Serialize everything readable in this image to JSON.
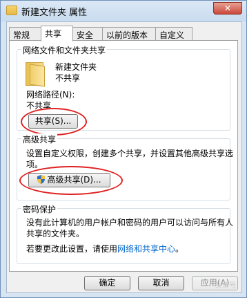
{
  "window": {
    "title": "新建文件夹 属性",
    "close_symbol": "✕"
  },
  "tabs": [
    {
      "label": "常规",
      "active": false
    },
    {
      "label": "共享",
      "active": true
    },
    {
      "label": "安全",
      "active": false
    },
    {
      "label": "以前的版本",
      "active": false
    },
    {
      "label": "自定义",
      "active": false
    }
  ],
  "network_share": {
    "title": "网络文件和文件夹共享",
    "folder_name": "新建文件夹",
    "folder_status": "不共享",
    "path_label": "网络路径(N):",
    "path_value": "不共享",
    "share_button": "共享(S)..."
  },
  "advanced_share": {
    "title": "高级共享",
    "description_line1": "设置自定义权限，创建多个共享，并设置其他高级共享选",
    "description_line2": "项。",
    "button": "高级共享(D)..."
  },
  "password": {
    "title": "密码保护",
    "line1": "没有此计算机的用户帐户和密码的用户可以访问与所有人",
    "line2": "共享的文件夹。",
    "line3_prefix": "若要更改此设置，请使用",
    "link_text": "网络和共享中心",
    "line3_suffix": "。"
  },
  "footer": {
    "ok": "确定",
    "cancel": "取消",
    "apply": "应用(A)"
  },
  "watermark": "头条号",
  "colors": {
    "highlight_ellipse": "#e02020",
    "link": "#0066cc"
  }
}
